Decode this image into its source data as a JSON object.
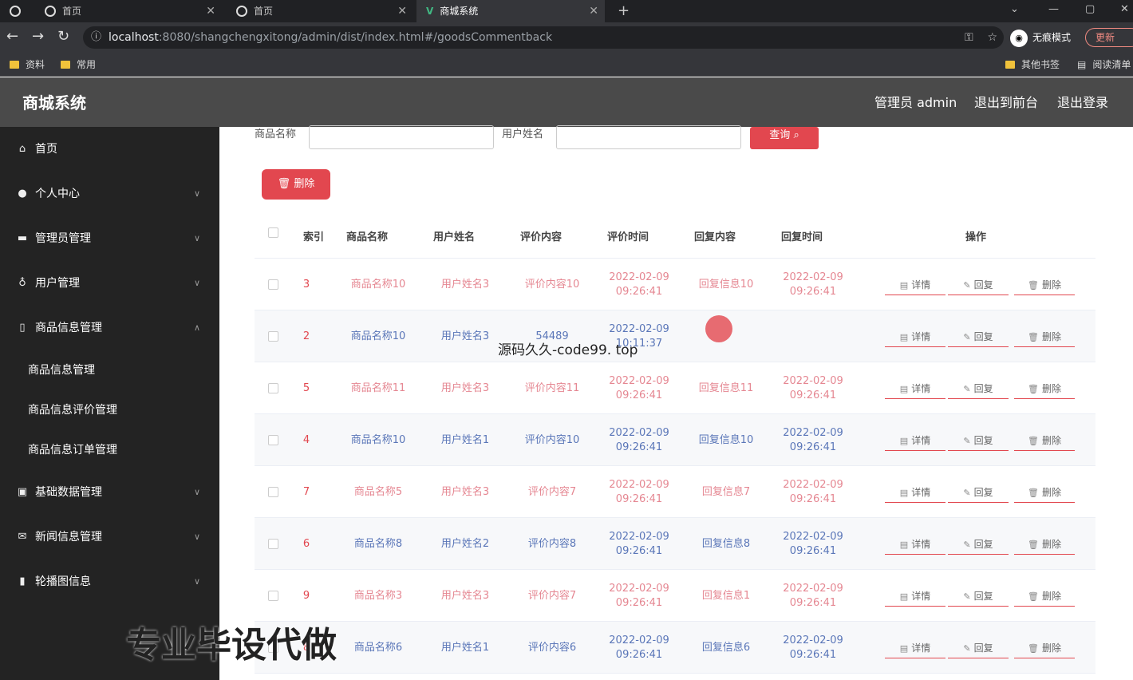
{
  "browser": {
    "tabs": [
      {
        "title": ""
      },
      {
        "title": "首页"
      },
      {
        "title": "首页"
      },
      {
        "title": "商城系统",
        "active": true
      }
    ],
    "url_host": "localhost",
    "url_path": ":8080/shangchengxitong/admin/dist/index.html#/goodsCommentback",
    "profile_label": "无痕模式",
    "update_label": "更新",
    "bookmarks": [
      "资料",
      "常用"
    ],
    "bookmarks_right": [
      "其他书签",
      "阅读清单"
    ]
  },
  "header": {
    "title": "商城系统",
    "admin_label": "管理员 admin",
    "to_front": "退出到前台",
    "logout": "退出登录"
  },
  "sidebar": {
    "items": [
      {
        "label": "首页"
      },
      {
        "label": "个人中心"
      },
      {
        "label": "管理员管理"
      },
      {
        "label": "用户管理"
      },
      {
        "label": "商品信息管理"
      },
      {
        "label": "基础数据管理"
      },
      {
        "label": "新闻信息管理"
      },
      {
        "label": "轮播图信息"
      }
    ],
    "sub_items": [
      {
        "label": "商品信息管理"
      },
      {
        "label": "商品信息评价管理"
      },
      {
        "label": "商品信息订单管理"
      }
    ]
  },
  "search": {
    "goods_label": "商品名称",
    "user_label": "用户姓名",
    "query_label": "查询",
    "delete_label": "删除"
  },
  "table": {
    "headers": [
      "索引",
      "商品名称",
      "用户姓名",
      "评价内容",
      "评价时间",
      "回复内容",
      "回复时间",
      "操作"
    ],
    "actions": {
      "detail": "详情",
      "reply": "回复",
      "delete": "删除"
    },
    "rows": [
      {
        "idx": "3",
        "goods": "商品名称10",
        "user": "用户姓名3",
        "content": "评价内容10",
        "time": "2022-02-09 09:26:41",
        "reply": "回复信息10",
        "reply_time": "2022-02-09 09:26:41"
      },
      {
        "idx": "2",
        "goods": "商品名称10",
        "user": "用户姓名3",
        "content": "54489",
        "time": "2022-02-09 10:11:37",
        "reply": "",
        "reply_time": ""
      },
      {
        "idx": "5",
        "goods": "商品名称11",
        "user": "用户姓名3",
        "content": "评价内容11",
        "time": "2022-02-09 09:26:41",
        "reply": "回复信息11",
        "reply_time": "2022-02-09 09:26:41"
      },
      {
        "idx": "4",
        "goods": "商品名称10",
        "user": "用户姓名1",
        "content": "评价内容10",
        "time": "2022-02-09 09:26:41",
        "reply": "回复信息10",
        "reply_time": "2022-02-09 09:26:41"
      },
      {
        "idx": "7",
        "goods": "商品名称5",
        "user": "用户姓名3",
        "content": "评价内容7",
        "time": "2022-02-09 09:26:41",
        "reply": "回复信息7",
        "reply_time": "2022-02-09 09:26:41"
      },
      {
        "idx": "6",
        "goods": "商品名称8",
        "user": "用户姓名2",
        "content": "评价内容8",
        "time": "2022-02-09 09:26:41",
        "reply": "回复信息8",
        "reply_time": "2022-02-09 09:26:41"
      },
      {
        "idx": "9",
        "goods": "商品名称3",
        "user": "用户姓名3",
        "content": "评价内容7",
        "time": "2022-02-09 09:26:41",
        "reply": "回复信息1",
        "reply_time": "2022-02-09 09:26:41"
      },
      {
        "idx": "8",
        "goods": "商品名称6",
        "user": "用户姓名1",
        "content": "评价内容6",
        "time": "2022-02-09 09:26:41",
        "reply": "回复信息6",
        "reply_time": "2022-02-09 09:26:41"
      }
    ]
  },
  "overlay": {
    "watermark": "源码久久-code99. top",
    "promo": "专业毕设代做"
  }
}
